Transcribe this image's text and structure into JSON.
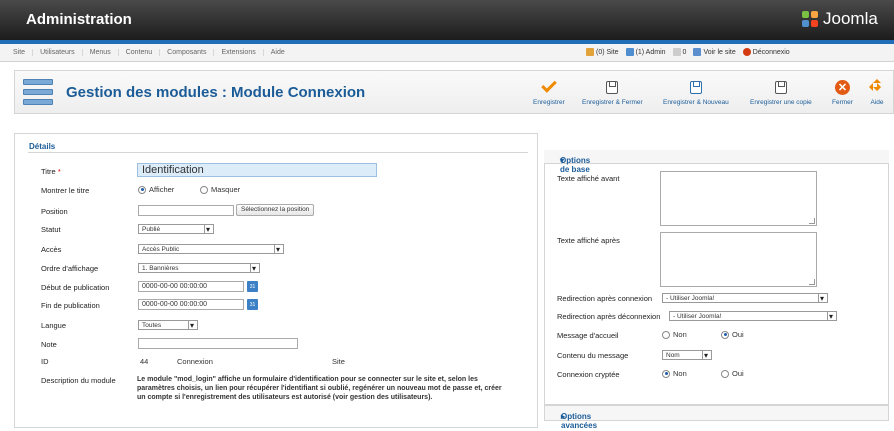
{
  "header": {
    "title": "Administration",
    "brand": "Joomla",
    "colors": {
      "accent": "#1f6eb7",
      "heading": "#1b5c98"
    }
  },
  "menu": {
    "items": [
      "Site",
      "Utilisateurs",
      "Menus",
      "Contenu",
      "Composants",
      "Extensions",
      "Aide"
    ]
  },
  "status": {
    "site": "(0) Site",
    "admin": "(1) Admin",
    "messages": "0",
    "view_site": "Voir le site",
    "logout": "Déconnexio"
  },
  "toolbar": {
    "page_title": "Gestion des modules : Module Connexion",
    "buttons": {
      "save": "Enregistrer",
      "save_close": "Enregistrer & Fermer",
      "save_new": "Enregistrer & Nouveau",
      "save_copy": "Enregistrer une copie",
      "close": "Fermer",
      "help": "Aide"
    }
  },
  "details": {
    "legend": "Détails",
    "title_label": "Titre",
    "title_required": "*",
    "title_value": "Identification",
    "show_title_label": "Montrer le titre",
    "show_title_options": [
      "Afficher",
      "Masquer"
    ],
    "show_title_selected": "Afficher",
    "position_label": "Position",
    "position_value": "",
    "position_button": "Sélectionnez la position",
    "status_label": "Statut",
    "status_value": "Publié",
    "access_label": "Accès",
    "access_value": "Accès Public",
    "ordering_label": "Ordre d'affichage",
    "ordering_value": "1. Bannières",
    "publish_up_label": "Début de publication",
    "publish_up_value": "0000-00-00 00:00:00",
    "publish_down_label": "Fin de publication",
    "publish_down_value": "0000-00-00 00:00:00",
    "calendar_icon_text": "31",
    "language_label": "Langue",
    "language_value": "Toutes",
    "note_label": "Note",
    "note_value": "",
    "id_label": "ID",
    "id_value": "44",
    "module_name": "Connexion",
    "module_client": "Site",
    "description_label": "Description du module",
    "description_text": "Le module \"mod_login\" affiche un formulaire d'identification pour se connecter sur le site et, selon les paramètres choisis, un lien pour récupérer l'identifiant si oublié, regénérer un nouveau mot de passe et, créer un compte si l'enregistrement des utilisateurs est autorisé (voir gestion des utilisateurs)."
  },
  "options": {
    "basic_title": "Options de base",
    "pretext_label": "Texte affiché avant",
    "posttext_label": "Texte affiché après",
    "login_redirect_label": "Redirection après connexion",
    "login_redirect_value": "- Utiliser Joomla!",
    "logout_redirect_label": "Redirection après déconnexion",
    "logout_redirect_value": "- Utiliser Joomla!",
    "greeting_label": "Message d'accueil",
    "greeting_options": [
      "Non",
      "Oui"
    ],
    "greeting_selected": "Oui",
    "name_label": "Contenu du message",
    "name_value": "Nom",
    "secure_label": "Connexion cryptée",
    "secure_options": [
      "Non",
      "Oui"
    ],
    "secure_selected": "Non",
    "advanced_title": "Options avancées"
  }
}
